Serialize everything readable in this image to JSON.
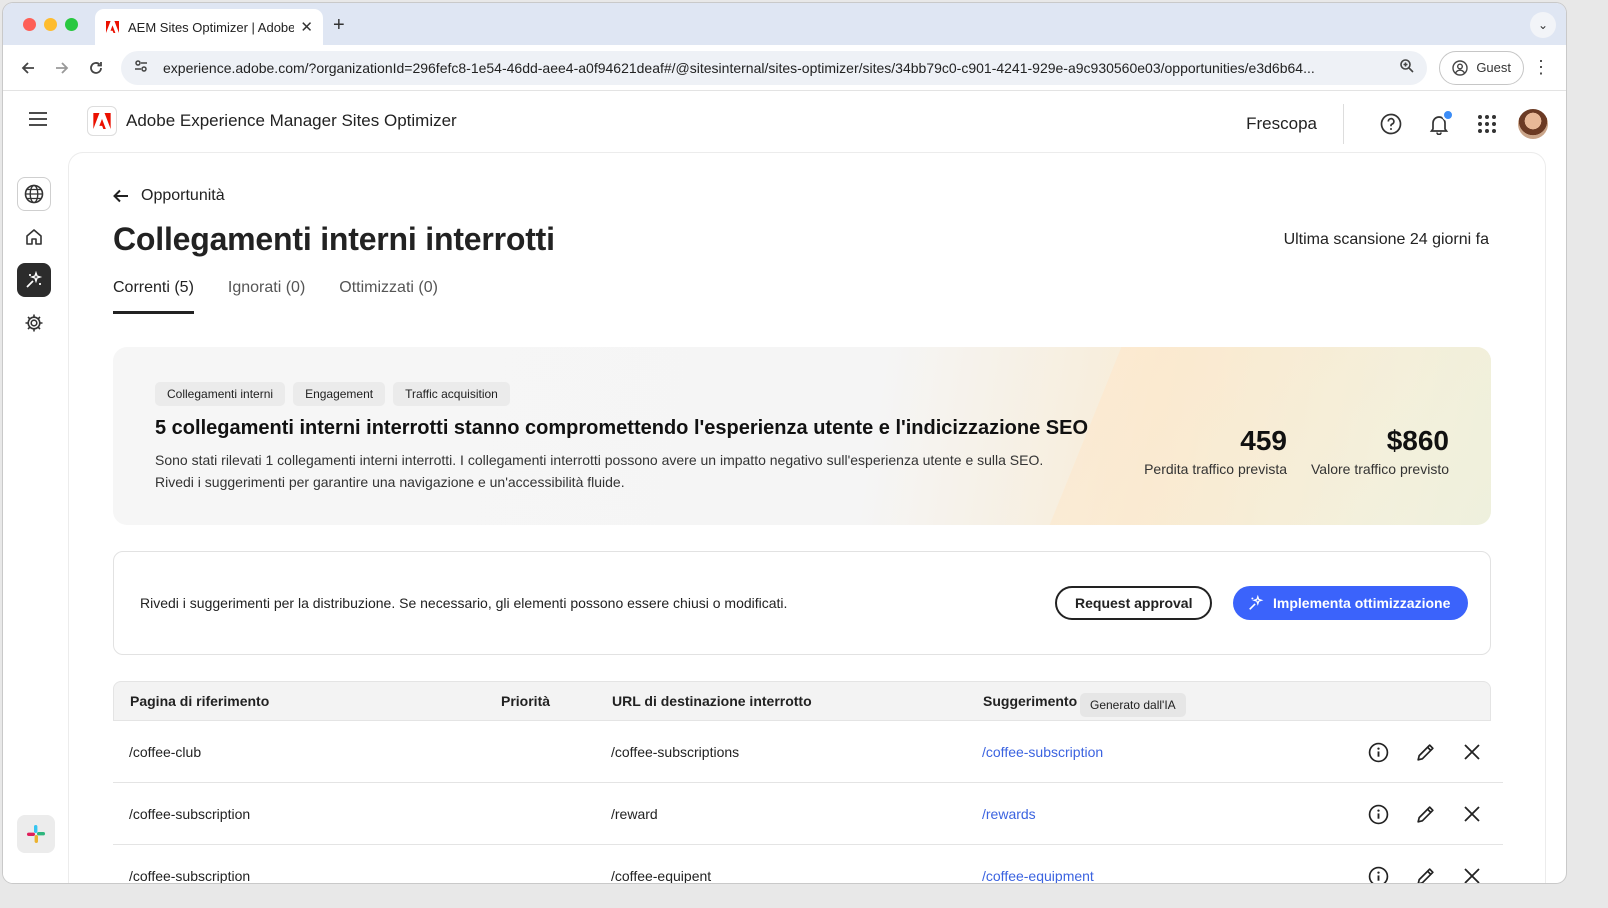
{
  "browser": {
    "tab_title": "AEM Sites Optimizer | Adobe",
    "url": "experience.adobe.com/?organizationId=296fefc8-1e54-46dd-aee4-a0f94621deaf#/@sitesinternal/sites-optimizer/sites/34bb79c0-c901-4241-929e-a9c930560e03/opportunities/e3d6b64...",
    "profile_label": "Guest"
  },
  "app": {
    "name": "Adobe Experience Manager Sites Optimizer",
    "org": "Frescopa"
  },
  "page": {
    "back_label": "Opportunità",
    "title": "Collegamenti interni interrotti",
    "last_scan": "Ultima scansione 24 giorni fa",
    "tabs": [
      {
        "label": "Correnti (5)",
        "selected": true
      },
      {
        "label": "Ignorati (0)",
        "selected": false
      },
      {
        "label": "Ottimizzati (0)",
        "selected": false
      }
    ]
  },
  "hero": {
    "chips": [
      "Collegamenti interni",
      "Engagement",
      "Traffic acquisition"
    ],
    "title": "5 collegamenti interni interrotti stanno compromettendo l'esperienza utente e l'indicizzazione SEO",
    "description": "Sono stati rilevati 1 collegamenti interni interrotti. I collegamenti interrotti possono avere un impatto negativo sull'esperienza utente e sulla SEO. Rivedi i suggerimenti per garantire una navigazione e un'accessibilità fluide.",
    "metrics": [
      {
        "value": "459",
        "label": "Perdita traffico prevista"
      },
      {
        "value": "$860",
        "label": "Valore traffico previsto"
      }
    ]
  },
  "actions": {
    "text": "Rivedi i suggerimenti per la distribuzione. Se necessario, gli elementi possono essere chiusi o modificati.",
    "request_label": "Request approval",
    "deploy_label": "Implementa ottimizzazione"
  },
  "table": {
    "headers": {
      "referrer": "Pagina di riferimento",
      "priority": "Priorità",
      "broken_url": "URL di destinazione interrotto",
      "suggestion": "Suggerimento",
      "ai_badge": "Generato dall'IA"
    },
    "rows": [
      {
        "referrer": "/coffee-club",
        "broken": "/coffee-subscriptions",
        "suggestion": "/coffee-subscription"
      },
      {
        "referrer": "/coffee-subscription",
        "broken": "/reward",
        "suggestion": "/rewards"
      },
      {
        "referrer": "/coffee-subscription",
        "broken": "/coffee-equipent",
        "suggestion": "/coffee-equipment"
      }
    ]
  },
  "colors": {
    "accent": "#3b63fb",
    "adobe_red": "#eb1000",
    "link": "#3b63e0"
  }
}
